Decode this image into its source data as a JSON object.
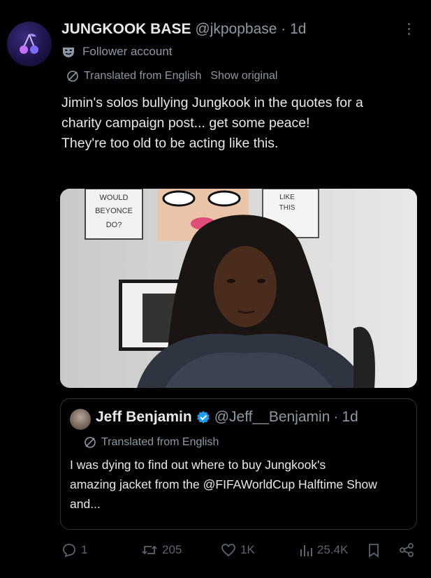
{
  "post": {
    "author_name": "JUNGKOOK BASE",
    "author_handle": "@jkpopbase",
    "time": "1d",
    "follower_label": "Follower account",
    "translated_label": "Translated from English",
    "show_original": "Show original",
    "text_lines": [
      "Jimin's solos bullying Jungkook in the quotes for a",
      "charity campaign post... get some peace!",
      "They're too old to be acting like this."
    ]
  },
  "media": {
    "sign_left": [
      "WOULD",
      "BEYONCE",
      "DO?"
    ],
    "sign_right": [
      "LIKE",
      "THIS"
    ]
  },
  "quote": {
    "author_name": "Jeff Benjamin",
    "author_handle": "@Jeff__Benjamin",
    "time": "1d",
    "translated_label": "Translated from English",
    "text_lines": [
      "I was dying to find out where to buy Jungkook's",
      "amazing jacket from the @FIFAWorldCup Halftime Show",
      "and..."
    ]
  },
  "actions": {
    "replies": "1",
    "reposts": "205",
    "likes": "1K",
    "views": "25.4K"
  },
  "colors": {
    "background": "#000000",
    "text": "#e7e9ea",
    "muted": "#8b98a5",
    "icon": "#5b6570",
    "verified": "#1d9bf0"
  }
}
